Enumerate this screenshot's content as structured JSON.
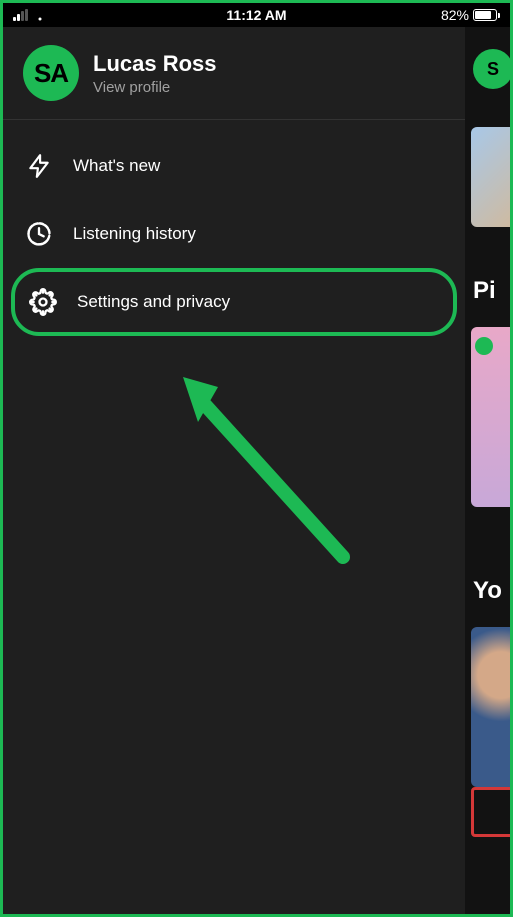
{
  "status_bar": {
    "time": "11:12 AM",
    "battery_percent": "82%"
  },
  "profile": {
    "avatar_initials": "SA",
    "name": "Lucas Ross",
    "subtitle": "View profile"
  },
  "menu": {
    "items": [
      {
        "label": "What's new",
        "icon": "lightning-icon"
      },
      {
        "label": "Listening history",
        "icon": "clock-icon"
      },
      {
        "label": "Settings and privacy",
        "icon": "gear-icon"
      }
    ]
  },
  "peek": {
    "avatar_initials": "S",
    "label1": "Pi",
    "label2": "Yo"
  },
  "annotation": {
    "highlight_color": "#1DB954"
  }
}
